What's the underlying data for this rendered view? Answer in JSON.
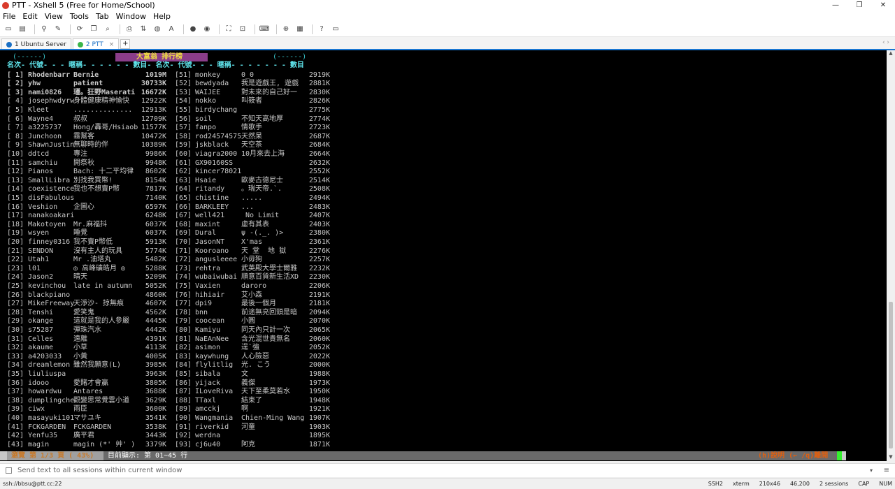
{
  "window": {
    "title": "PTT - Xshell 5 (Free for Home/School)",
    "controls": [
      "—",
      "❐",
      "✕"
    ]
  },
  "menu": [
    "File",
    "Edit",
    "View",
    "Tools",
    "Tab",
    "Window",
    "Help"
  ],
  "tabs": [
    {
      "label": "1 Ubuntu Server",
      "color": "#1a6fc4",
      "active": false
    },
    {
      "label": "2 PTT",
      "color": "#3bb54a",
      "active": true
    }
  ],
  "tab_add": "+",
  "terminal": {
    "header_title": "大富翁 排行榜",
    "header_deco_left": "(------)",
    "header_deco_right": "(------)",
    "col_header": "名次- 代號- - - 暱稱- - - - - - 數目- 名次- 代號- - - 暱稱- - - - - - - 數目",
    "rows_left": [
      {
        "rank": "[ 1]",
        "id": "Rhodenbarr",
        "nick": "Bernie",
        "amount": "1019M",
        "style": "gold"
      },
      {
        "rank": "[ 2]",
        "id": "yhw",
        "nick": "patient",
        "amount": "30733K",
        "style": "green"
      },
      {
        "rank": "[ 3]",
        "id": "nami0826",
        "nick": "瑾。狂野Maserati",
        "amount": "16672K",
        "style": "yellow"
      },
      {
        "rank": "[ 4]",
        "id": "josephwdyrw",
        "nick": "身體健康精神愉快",
        "amount": "12922K"
      },
      {
        "rank": "[ 5]",
        "id": "Kleet",
        "nick": "..............",
        "amount": "12913K"
      },
      {
        "rank": "[ 6]",
        "id": "Wayne4",
        "nick": "叔叔",
        "amount": "12709K"
      },
      {
        "rank": "[ 7]",
        "id": "a3225737",
        "nick": "Hong/轟哥/Hsiaob",
        "amount": "11577K"
      },
      {
        "rank": "[ 8]",
        "id": "Junchoon",
        "nick": "霧幫客",
        "amount": "10472K"
      },
      {
        "rank": "[ 9]",
        "id": "ShawnJustin",
        "nick": "無聊時的伴",
        "amount": "10389K"
      },
      {
        "rank": "[10]",
        "id": "ddtcd",
        "nick": "專注",
        "amount": "9986K"
      },
      {
        "rank": "[11]",
        "id": "samchiu",
        "nick": "開祭秋",
        "amount": "9948K"
      },
      {
        "rank": "[12]",
        "id": "Pianos",
        "nick": "Bach: 十二平均律",
        "amount": "8602K"
      },
      {
        "rank": "[13]",
        "id": "SmallLibra",
        "nick": "別找我買幣!",
        "amount": "8154K"
      },
      {
        "rank": "[14]",
        "id": "coexistence",
        "nick": "我也不想賣P幣",
        "amount": "7817K"
      },
      {
        "rank": "[15]",
        "id": "disFabulous",
        "nick": "",
        "amount": "7140K"
      },
      {
        "rank": "[16]",
        "id": "Veshion",
        "nick": "企圖心",
        "amount": "6597K"
      },
      {
        "rank": "[17]",
        "id": "nanakoakari",
        "nick": "",
        "amount": "6248K"
      },
      {
        "rank": "[18]",
        "id": "Makotoyen",
        "nick": "Mr.麻福抖",
        "amount": "6037K"
      },
      {
        "rank": "[19]",
        "id": "wsyen",
        "nick": "睡覺",
        "amount": "6037K"
      },
      {
        "rank": "[20]",
        "id": "finney0316",
        "nick": "我不賣P幣低",
        "amount": "5913K"
      },
      {
        "rank": "[21]",
        "id": "SENDON",
        "nick": "沒有主人的玩具",
        "amount": "5774K"
      },
      {
        "rank": "[22]",
        "id": "Utah1",
        "nick": "Mr .油塔丸",
        "amount": "5482K"
      },
      {
        "rank": "[23]",
        "id": "l01",
        "nick": "◎ 高峰礦皓月 ◎",
        "amount": "5288K"
      },
      {
        "rank": "[24]",
        "id": "Jason2",
        "nick": "晴天",
        "amount": "5209K"
      },
      {
        "rank": "[25]",
        "id": "kevinchou",
        "nick": "late in autumn",
        "amount": "5052K"
      },
      {
        "rank": "[26]",
        "id": "blackpiano",
        "nick": "",
        "amount": "4860K"
      },
      {
        "rank": "[27]",
        "id": "MikeFreeway",
        "nick": "天淨沙- 掠無痕",
        "amount": "4607K"
      },
      {
        "rank": "[28]",
        "id": "Tenshi",
        "nick": "愛笑鬼",
        "amount": "4562K"
      },
      {
        "rank": "[29]",
        "id": "okange",
        "nick": "這就是我的人參嚴",
        "amount": "4445K"
      },
      {
        "rank": "[30]",
        "id": "s75287",
        "nick": "彈珠汽水",
        "amount": "4442K"
      },
      {
        "rank": "[31]",
        "id": "Celles",
        "nick": "遠離",
        "amount": "4391K"
      },
      {
        "rank": "[32]",
        "id": "akaume",
        "nick": "小草",
        "amount": "4113K"
      },
      {
        "rank": "[33]",
        "id": "a4203033",
        "nick": "小黃",
        "amount": "4005K"
      },
      {
        "rank": "[34]",
        "id": "dreamlemon",
        "nick": "雖然我願意(L)",
        "amount": "3985K"
      },
      {
        "rank": "[35]",
        "id": "liuliuspa",
        "nick": "",
        "amount": "3963K"
      },
      {
        "rank": "[36]",
        "id": "idooo",
        "nick": "愛賭才會贏",
        "amount": "3805K"
      },
      {
        "rank": "[37]",
        "id": "howardwu",
        "nick": "Antares",
        "amount": "3688K"
      },
      {
        "rank": "[38]",
        "id": "dumplingche",
        "nick": "觀變思常覺雲小道",
        "amount": "3629K"
      },
      {
        "rank": "[39]",
        "id": "ciwx",
        "nick": "雨臣",
        "amount": "3600K"
      },
      {
        "rank": "[40]",
        "id": "masayuki101",
        "nick": "マサユキ",
        "amount": "3541K"
      },
      {
        "rank": "[41]",
        "id": "FCKGARDEN",
        "nick": "FCKGARDEN",
        "amount": "3538K"
      },
      {
        "rank": "[42]",
        "id": "Yenfu35",
        "nick": "廣平君",
        "amount": "3443K"
      },
      {
        "rank": "[43]",
        "id": "magin",
        "nick": "magin (*' 艸' )",
        "amount": "3379K"
      }
    ],
    "rows_right": [
      {
        "rank": "[51]",
        "id": "monkey",
        "nick": "0_0",
        "amount": "2919K"
      },
      {
        "rank": "[52]",
        "id": "bewdyada",
        "nick": "我是遊戲王, 遊戲",
        "amount": "2881K"
      },
      {
        "rank": "[53]",
        "id": "WAIJEE",
        "nick": "對未來的自己好一",
        "amount": "2830K"
      },
      {
        "rank": "[54]",
        "id": "nokko",
        "nick": "叫筱者",
        "amount": "2826K"
      },
      {
        "rank": "[55]",
        "id": "birdychang",
        "nick": "",
        "amount": "2775K"
      },
      {
        "rank": "[56]",
        "id": "soil",
        "nick": "不知天高地厚",
        "amount": "2774K"
      },
      {
        "rank": "[57]",
        "id": "fanpo",
        "nick": "情歌手",
        "amount": "2723K"
      },
      {
        "rank": "[58]",
        "id": "rod24574575",
        "nick": "天然呆",
        "amount": "2687K"
      },
      {
        "rank": "[59]",
        "id": "jskblack",
        "nick": "天空茶",
        "amount": "2684K"
      },
      {
        "rank": "[60]",
        "id": "viagra2000",
        "nick": "10月來去上海",
        "amount": "2664K"
      },
      {
        "rank": "[61]",
        "id": "GX90160SS",
        "nick": "",
        "amount": "2632K"
      },
      {
        "rank": "[62]",
        "id": "kincer78021",
        "nick": "",
        "amount": "2552K"
      },
      {
        "rank": "[63]",
        "id": "Hsaie",
        "nick": "歐麥古德尼士",
        "amount": "2514K"
      },
      {
        "rank": "[64]",
        "id": "ritandy",
        "nick": "。瑞天帝.`.",
        "amount": "2508K"
      },
      {
        "rank": "[65]",
        "id": "chistine",
        "nick": ".....",
        "amount": "2494K"
      },
      {
        "rank": "[66]",
        "id": "BARKLEEY",
        "nick": "...",
        "amount": "2483K"
      },
      {
        "rank": "[67]",
        "id": "well421",
        "nick": " No Limit",
        "amount": "2407K"
      },
      {
        "rank": "[68]",
        "id": "maxint",
        "nick": "虛有其表",
        "amount": "2403K"
      },
      {
        "rank": "[69]",
        "id": "Dural",
        "nick": "ψ -(._. )>",
        "amount": "2380K"
      },
      {
        "rank": "[70]",
        "id": "JasonNT",
        "nick": "X'mas",
        "amount": "2361K"
      },
      {
        "rank": "[71]",
        "id": "Kooroano",
        "nick": "天 堂  地 獄",
        "amount": "2276K"
      },
      {
        "rank": "[72]",
        "id": "angusleeee",
        "nick": "小毋狗",
        "amount": "2257K"
      },
      {
        "rank": "[73]",
        "id": "rehtra",
        "nick": "武英殿大學士爾雅",
        "amount": "2232K"
      },
      {
        "rank": "[74]",
        "id": "wubaiwubai",
        "nick": "順意百貨新生活XD",
        "amount": "2230K"
      },
      {
        "rank": "[75]",
        "id": "Vaxien",
        "nick": "daroro",
        "amount": "2206K"
      },
      {
        "rank": "[76]",
        "id": "hihiair",
        "nick": "艾小森",
        "amount": "2191K"
      },
      {
        "rank": "[77]",
        "id": "dpi9",
        "nick": "最後一個月",
        "amount": "2181K"
      },
      {
        "rank": "[78]",
        "id": "bnn",
        "nick": "前途無亮回頭是暗",
        "amount": "2094K"
      },
      {
        "rank": "[79]",
        "id": "coocean",
        "nick": "小圓",
        "amount": "2070K"
      },
      {
        "rank": "[80]",
        "id": "Kamiyu",
        "nick": "同天內只計一次",
        "amount": "2065K"
      },
      {
        "rank": "[81]",
        "id": "NaEAnNee",
        "nick": "含光混世貴無名",
        "amount": "2060K"
      },
      {
        "rank": "[82]",
        "id": "asimon",
        "nick": "逞`強",
        "amount": "2052K"
      },
      {
        "rank": "[83]",
        "id": "kaywhung",
        "nick": "人心險惡",
        "amount": "2022K"
      },
      {
        "rank": "[84]",
        "id": "flylitlig",
        "nick": "光. こう",
        "amount": "2000K"
      },
      {
        "rank": "[85]",
        "id": "sibala",
        "nick": "文",
        "amount": "1988K"
      },
      {
        "rank": "[86]",
        "id": "yijack",
        "nick": "義傑",
        "amount": "1973K"
      },
      {
        "rank": "[87]",
        "id": "ILoveRiva",
        "nick": "天下至柔莫若水",
        "amount": "1950K"
      },
      {
        "rank": "[88]",
        "id": "TTaxl",
        "nick": "結束了",
        "amount": "1948K"
      },
      {
        "rank": "[89]",
        "id": "amcckj",
        "nick": "啊",
        "amount": "1921K"
      },
      {
        "rank": "[90]",
        "id": "Wangmania",
        "nick": "Chien-Ming Wang",
        "amount": "1907K"
      },
      {
        "rank": "[91]",
        "id": "riverkid",
        "nick": "河童",
        "amount": "1903K"
      },
      {
        "rank": "[92]",
        "id": "werdna",
        "nick": "",
        "amount": "1895K"
      },
      {
        "rank": "[93]",
        "id": "cj6u40",
        "nick": "阿克",
        "amount": "1871K"
      }
    ],
    "status_page": "瀏覽 第 1/3 頁 ( 43%)",
    "status_show": "目前顯示: 第 01~45 行",
    "status_help": "(h)說明 (← /q)離開"
  },
  "sendbar": {
    "placeholder": "Send text to all sessions within current window",
    "menu_icon": "≡",
    "dropdown": "▾"
  },
  "statusbar": {
    "connection": "ssh://bbsu@ptt.cc:22",
    "protocol": "SSH2",
    "term": "xterm",
    "size": "210x46",
    "cursor_pos": "46,200",
    "sessions": "2 sessions",
    "caps": "CAP",
    "num": "NUM"
  }
}
